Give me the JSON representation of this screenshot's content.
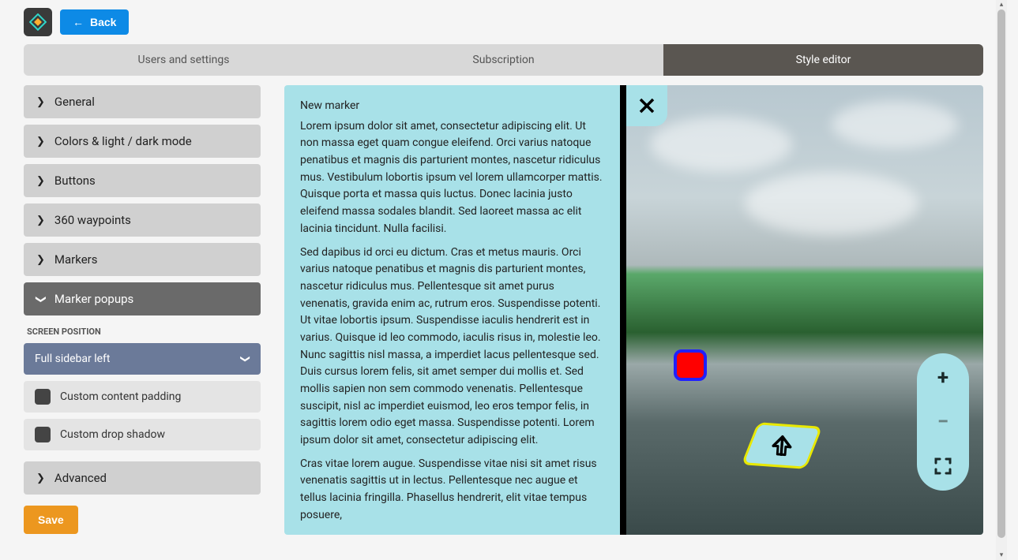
{
  "header": {
    "back_label": "Back"
  },
  "tabs": [
    {
      "label": "Users and settings"
    },
    {
      "label": "Subscription"
    },
    {
      "label": "Style editor"
    }
  ],
  "sidebar": {
    "items": [
      {
        "label": "General"
      },
      {
        "label": "Colors & light / dark mode"
      },
      {
        "label": "Buttons"
      },
      {
        "label": "360 waypoints"
      },
      {
        "label": "Markers"
      },
      {
        "label": "Marker popups"
      }
    ],
    "section_label": "SCREEN POSITION",
    "select_value": "Full sidebar left",
    "options": [
      {
        "label": "Custom content padding"
      },
      {
        "label": "Custom drop shadow"
      }
    ],
    "advanced_label": "Advanced",
    "save_label": "Save"
  },
  "popup": {
    "title": "New marker",
    "p1": "Lorem ipsum dolor sit amet, consectetur adipiscing elit. Ut non massa eget quam congue eleifend. Orci varius natoque penatibus et magnis dis parturient montes, nascetur ridiculus mus. Vestibulum lobortis ipsum vel lorem ullamcorper mattis. Quisque porta et massa quis luctus. Donec lacinia justo eleifend massa sodales blandit. Sed laoreet massa ac elit lacinia tincidunt. Nulla facilisi.",
    "p2": "Sed dapibus id orci eu dictum. Cras et metus mauris. Orci varius natoque penatibus et magnis dis parturient montes, nascetur ridiculus mus. Pellentesque sit amet purus venenatis, gravida enim ac, rutrum eros. Suspendisse potenti. Ut vitae lobortis ipsum. Suspendisse iaculis hendrerit est in varius. Quisque id leo commodo, iaculis risus in, molestie leo. Nunc sagittis nisl massa, a imperdiet lacus pellentesque sed. Duis cursus lorem felis, sit amet semper dui mollis et. Sed mollis sapien non sem commodo venenatis. Pellentesque suscipit, nisl ac imperdiet euismod, leo eros tempor felis, in sagittis lorem odio eget massa. Suspendisse potenti. Lorem ipsum dolor sit amet, consectetur adipiscing elit.",
    "p3": "Cras vitae lorem augue. Suspendisse vitae nisi sit amet risus venenatis sagittis ut in lectus. Pellentesque nec augue et tellus lacinia fringilla. Phasellus hendrerit, elit vitae tempus posuere,"
  }
}
